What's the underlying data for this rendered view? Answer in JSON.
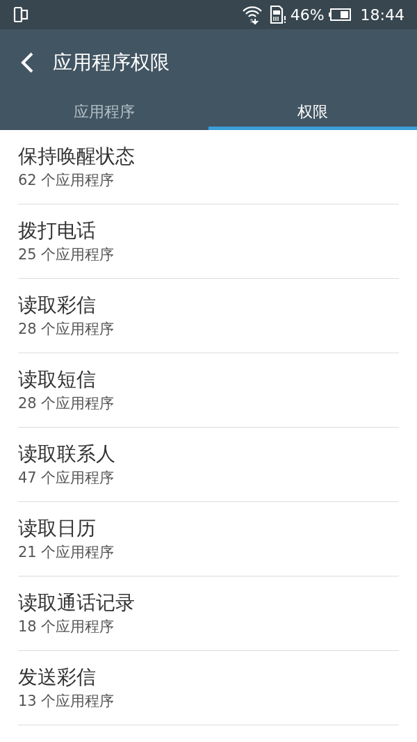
{
  "status_bar": {
    "battery_text": "46%",
    "time": "18:44"
  },
  "toolbar": {
    "title": "应用程序权限"
  },
  "tabs": [
    {
      "label": "应用程序",
      "selected": false
    },
    {
      "label": "权限",
      "selected": true
    }
  ],
  "permissions": [
    {
      "name": "保持唤醒状态",
      "count": "62 个应用程序"
    },
    {
      "name": "拨打电话",
      "count": "25 个应用程序"
    },
    {
      "name": "读取彩信",
      "count": "28 个应用程序"
    },
    {
      "name": "读取短信",
      "count": "28 个应用程序"
    },
    {
      "name": "读取联系人",
      "count": "47 个应用程序"
    },
    {
      "name": "读取日历",
      "count": "21 个应用程序"
    },
    {
      "name": "读取通话记录",
      "count": "18 个应用程序"
    },
    {
      "name": "发送彩信",
      "count": "13 个应用程序"
    }
  ]
}
